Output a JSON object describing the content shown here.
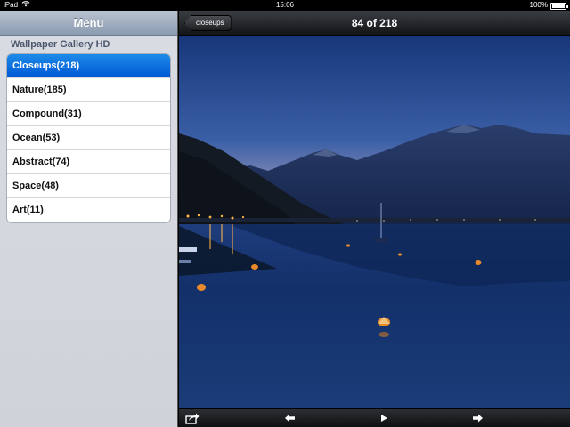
{
  "statusbar": {
    "device": "iPad",
    "time": "15:06",
    "battery": "100%",
    "battery_level": 1.0
  },
  "sidebar": {
    "title": "Menu",
    "section": "Wallpaper Gallery HD",
    "items": [
      {
        "label": "Closeups(218)",
        "selected": true
      },
      {
        "label": "Nature(185)",
        "selected": false
      },
      {
        "label": "Compound(31)",
        "selected": false
      },
      {
        "label": "Ocean(53)",
        "selected": false
      },
      {
        "label": "Abstract(74)",
        "selected": false
      },
      {
        "label": "Space(48)",
        "selected": false
      },
      {
        "label": "Art(11)",
        "selected": false
      }
    ]
  },
  "navbar": {
    "back_label": "closeups",
    "title": "84 of 218"
  },
  "toolbar": {
    "icons": [
      "share-icon",
      "previous-arrow-icon",
      "play-icon",
      "next-arrow-icon"
    ]
  },
  "colors": {
    "selected_item": "#0a6fe0",
    "sky_top": "#17377a",
    "sky_horizon": "#d8c3c8",
    "water": "#0d2554"
  }
}
